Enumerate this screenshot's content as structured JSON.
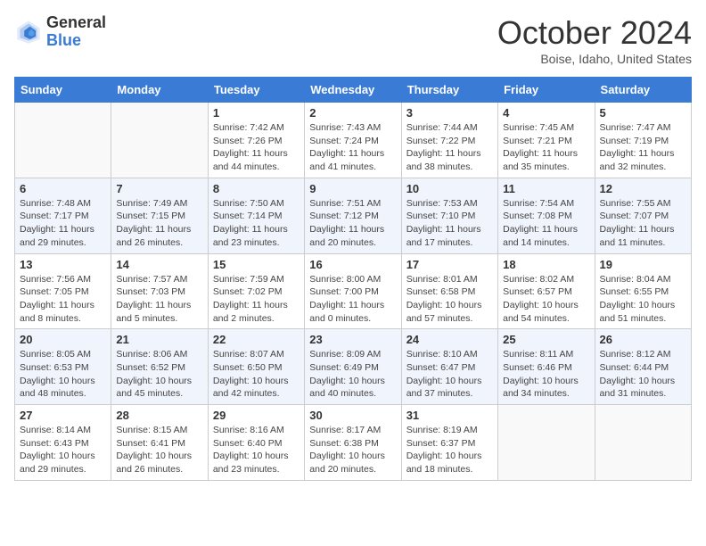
{
  "header": {
    "logo_general": "General",
    "logo_blue": "Blue",
    "month_title": "October 2024",
    "location": "Boise, Idaho, United States"
  },
  "days_of_week": [
    "Sunday",
    "Monday",
    "Tuesday",
    "Wednesday",
    "Thursday",
    "Friday",
    "Saturday"
  ],
  "weeks": [
    [
      {
        "day": "",
        "sunrise": "",
        "sunset": "",
        "daylight": ""
      },
      {
        "day": "",
        "sunrise": "",
        "sunset": "",
        "daylight": ""
      },
      {
        "day": "1",
        "sunrise": "Sunrise: 7:42 AM",
        "sunset": "Sunset: 7:26 PM",
        "daylight": "Daylight: 11 hours and 44 minutes."
      },
      {
        "day": "2",
        "sunrise": "Sunrise: 7:43 AM",
        "sunset": "Sunset: 7:24 PM",
        "daylight": "Daylight: 11 hours and 41 minutes."
      },
      {
        "day": "3",
        "sunrise": "Sunrise: 7:44 AM",
        "sunset": "Sunset: 7:22 PM",
        "daylight": "Daylight: 11 hours and 38 minutes."
      },
      {
        "day": "4",
        "sunrise": "Sunrise: 7:45 AM",
        "sunset": "Sunset: 7:21 PM",
        "daylight": "Daylight: 11 hours and 35 minutes."
      },
      {
        "day": "5",
        "sunrise": "Sunrise: 7:47 AM",
        "sunset": "Sunset: 7:19 PM",
        "daylight": "Daylight: 11 hours and 32 minutes."
      }
    ],
    [
      {
        "day": "6",
        "sunrise": "Sunrise: 7:48 AM",
        "sunset": "Sunset: 7:17 PM",
        "daylight": "Daylight: 11 hours and 29 minutes."
      },
      {
        "day": "7",
        "sunrise": "Sunrise: 7:49 AM",
        "sunset": "Sunset: 7:15 PM",
        "daylight": "Daylight: 11 hours and 26 minutes."
      },
      {
        "day": "8",
        "sunrise": "Sunrise: 7:50 AM",
        "sunset": "Sunset: 7:14 PM",
        "daylight": "Daylight: 11 hours and 23 minutes."
      },
      {
        "day": "9",
        "sunrise": "Sunrise: 7:51 AM",
        "sunset": "Sunset: 7:12 PM",
        "daylight": "Daylight: 11 hours and 20 minutes."
      },
      {
        "day": "10",
        "sunrise": "Sunrise: 7:53 AM",
        "sunset": "Sunset: 7:10 PM",
        "daylight": "Daylight: 11 hours and 17 minutes."
      },
      {
        "day": "11",
        "sunrise": "Sunrise: 7:54 AM",
        "sunset": "Sunset: 7:08 PM",
        "daylight": "Daylight: 11 hours and 14 minutes."
      },
      {
        "day": "12",
        "sunrise": "Sunrise: 7:55 AM",
        "sunset": "Sunset: 7:07 PM",
        "daylight": "Daylight: 11 hours and 11 minutes."
      }
    ],
    [
      {
        "day": "13",
        "sunrise": "Sunrise: 7:56 AM",
        "sunset": "Sunset: 7:05 PM",
        "daylight": "Daylight: 11 hours and 8 minutes."
      },
      {
        "day": "14",
        "sunrise": "Sunrise: 7:57 AM",
        "sunset": "Sunset: 7:03 PM",
        "daylight": "Daylight: 11 hours and 5 minutes."
      },
      {
        "day": "15",
        "sunrise": "Sunrise: 7:59 AM",
        "sunset": "Sunset: 7:02 PM",
        "daylight": "Daylight: 11 hours and 2 minutes."
      },
      {
        "day": "16",
        "sunrise": "Sunrise: 8:00 AM",
        "sunset": "Sunset: 7:00 PM",
        "daylight": "Daylight: 11 hours and 0 minutes."
      },
      {
        "day": "17",
        "sunrise": "Sunrise: 8:01 AM",
        "sunset": "Sunset: 6:58 PM",
        "daylight": "Daylight: 10 hours and 57 minutes."
      },
      {
        "day": "18",
        "sunrise": "Sunrise: 8:02 AM",
        "sunset": "Sunset: 6:57 PM",
        "daylight": "Daylight: 10 hours and 54 minutes."
      },
      {
        "day": "19",
        "sunrise": "Sunrise: 8:04 AM",
        "sunset": "Sunset: 6:55 PM",
        "daylight": "Daylight: 10 hours and 51 minutes."
      }
    ],
    [
      {
        "day": "20",
        "sunrise": "Sunrise: 8:05 AM",
        "sunset": "Sunset: 6:53 PM",
        "daylight": "Daylight: 10 hours and 48 minutes."
      },
      {
        "day": "21",
        "sunrise": "Sunrise: 8:06 AM",
        "sunset": "Sunset: 6:52 PM",
        "daylight": "Daylight: 10 hours and 45 minutes."
      },
      {
        "day": "22",
        "sunrise": "Sunrise: 8:07 AM",
        "sunset": "Sunset: 6:50 PM",
        "daylight": "Daylight: 10 hours and 42 minutes."
      },
      {
        "day": "23",
        "sunrise": "Sunrise: 8:09 AM",
        "sunset": "Sunset: 6:49 PM",
        "daylight": "Daylight: 10 hours and 40 minutes."
      },
      {
        "day": "24",
        "sunrise": "Sunrise: 8:10 AM",
        "sunset": "Sunset: 6:47 PM",
        "daylight": "Daylight: 10 hours and 37 minutes."
      },
      {
        "day": "25",
        "sunrise": "Sunrise: 8:11 AM",
        "sunset": "Sunset: 6:46 PM",
        "daylight": "Daylight: 10 hours and 34 minutes."
      },
      {
        "day": "26",
        "sunrise": "Sunrise: 8:12 AM",
        "sunset": "Sunset: 6:44 PM",
        "daylight": "Daylight: 10 hours and 31 minutes."
      }
    ],
    [
      {
        "day": "27",
        "sunrise": "Sunrise: 8:14 AM",
        "sunset": "Sunset: 6:43 PM",
        "daylight": "Daylight: 10 hours and 29 minutes."
      },
      {
        "day": "28",
        "sunrise": "Sunrise: 8:15 AM",
        "sunset": "Sunset: 6:41 PM",
        "daylight": "Daylight: 10 hours and 26 minutes."
      },
      {
        "day": "29",
        "sunrise": "Sunrise: 8:16 AM",
        "sunset": "Sunset: 6:40 PM",
        "daylight": "Daylight: 10 hours and 23 minutes."
      },
      {
        "day": "30",
        "sunrise": "Sunrise: 8:17 AM",
        "sunset": "Sunset: 6:38 PM",
        "daylight": "Daylight: 10 hours and 20 minutes."
      },
      {
        "day": "31",
        "sunrise": "Sunrise: 8:19 AM",
        "sunset": "Sunset: 6:37 PM",
        "daylight": "Daylight: 10 hours and 18 minutes."
      },
      {
        "day": "",
        "sunrise": "",
        "sunset": "",
        "daylight": ""
      },
      {
        "day": "",
        "sunrise": "",
        "sunset": "",
        "daylight": ""
      }
    ]
  ]
}
